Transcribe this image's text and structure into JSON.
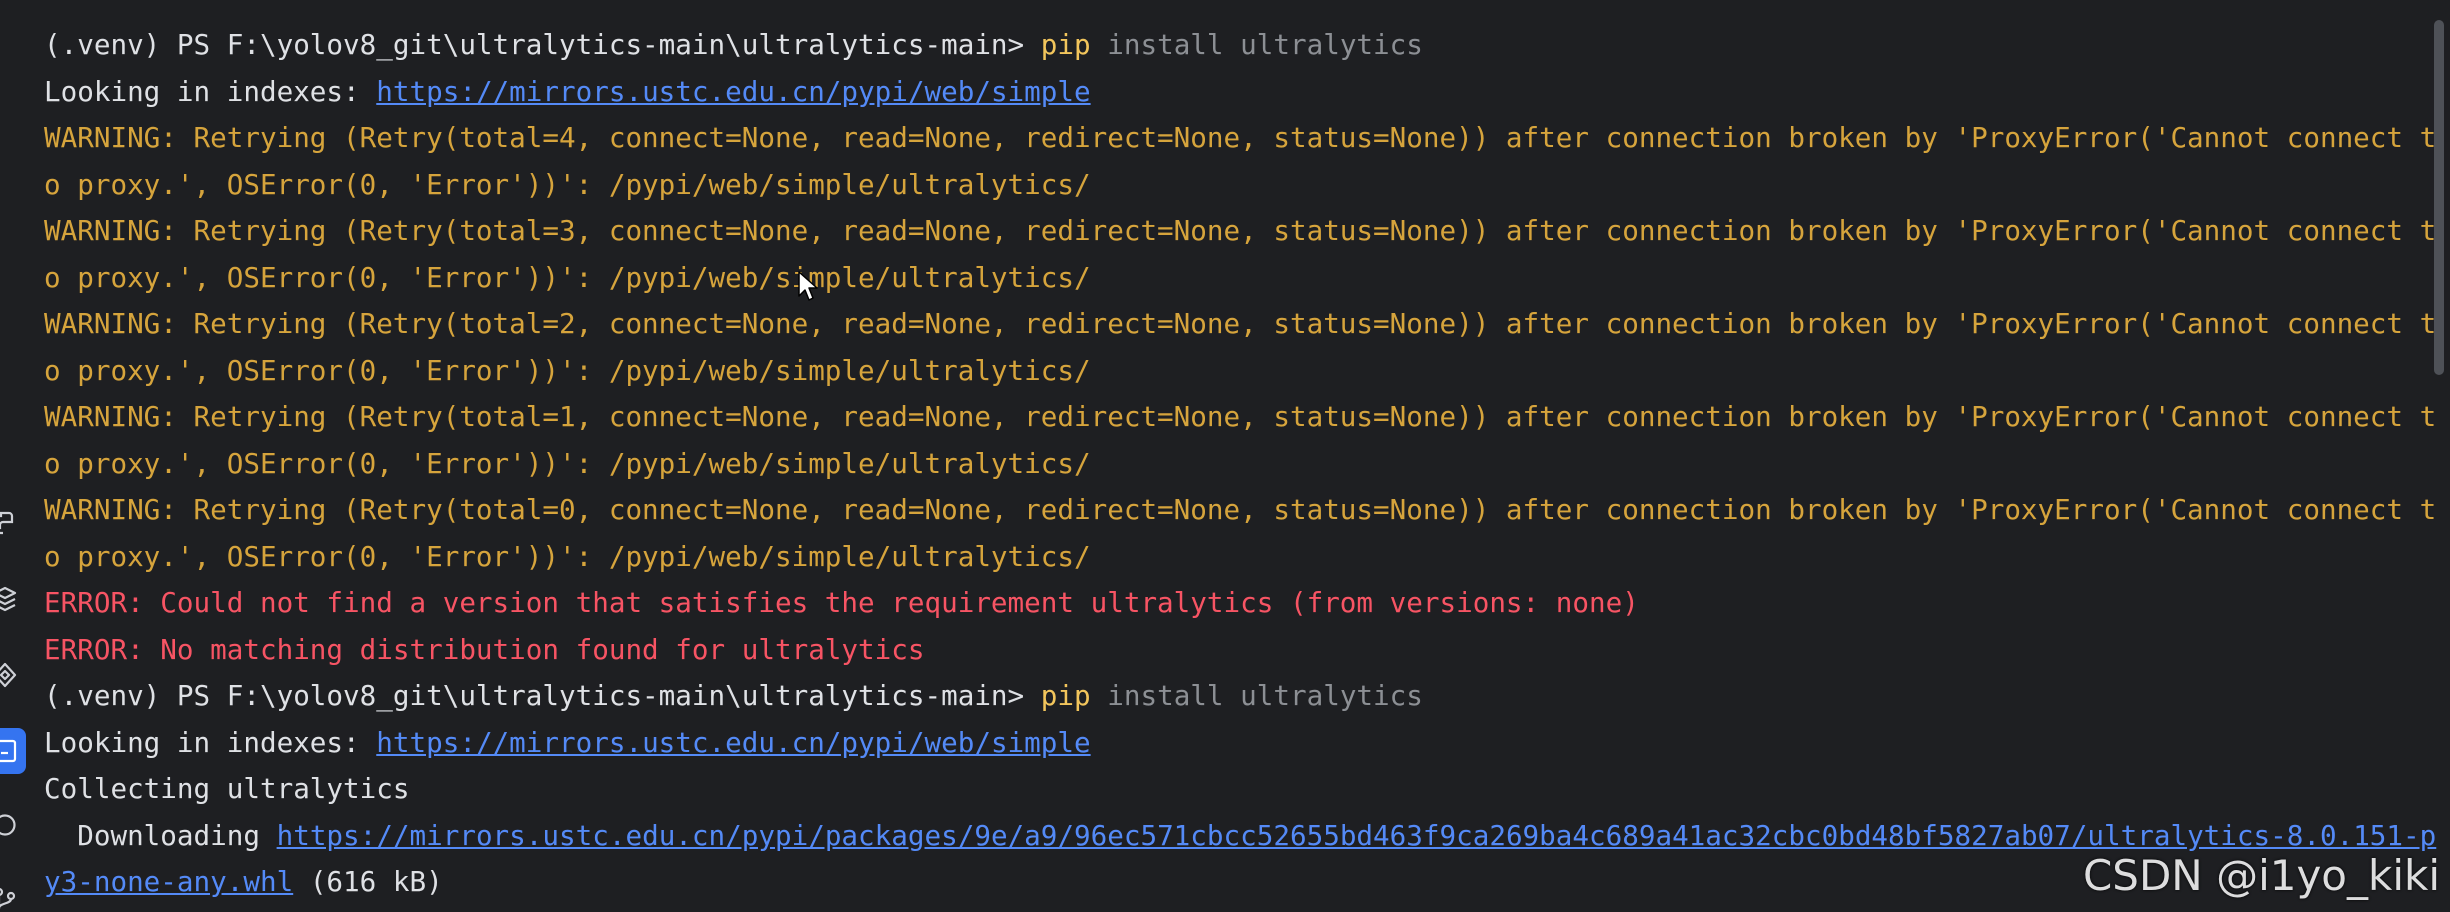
{
  "terminal": {
    "lines": [
      {
        "type": "command",
        "prompt": "(.venv) PS F:\\yolov8_git\\ultralytics-main\\ultralytics-main> ",
        "cmd": "pip",
        "args": " install ultralytics"
      },
      {
        "type": "index",
        "text": "Looking in indexes: ",
        "link": "https://mirrors.ustc.edu.cn/pypi/web/simple"
      },
      {
        "type": "warn",
        "text": "WARNING: Retrying (Retry(total=4, connect=None, read=None, redirect=None, status=None)) after connection broken by 'ProxyError('Cannot connect t"
      },
      {
        "type": "warn",
        "text": "o proxy.', OSError(0, 'Error'))': /pypi/web/simple/ultralytics/"
      },
      {
        "type": "warn",
        "text": "WARNING: Retrying (Retry(total=3, connect=None, read=None, redirect=None, status=None)) after connection broken by 'ProxyError('Cannot connect t"
      },
      {
        "type": "warn",
        "text": "o proxy.', OSError(0, 'Error'))': /pypi/web/simple/ultralytics/"
      },
      {
        "type": "warn",
        "text": "WARNING: Retrying (Retry(total=2, connect=None, read=None, redirect=None, status=None)) after connection broken by 'ProxyError('Cannot connect t"
      },
      {
        "type": "warn",
        "text": "o proxy.', OSError(0, 'Error'))': /pypi/web/simple/ultralytics/"
      },
      {
        "type": "warn",
        "text": "WARNING: Retrying (Retry(total=1, connect=None, read=None, redirect=None, status=None)) after connection broken by 'ProxyError('Cannot connect t"
      },
      {
        "type": "warn",
        "text": "o proxy.', OSError(0, 'Error'))': /pypi/web/simple/ultralytics/"
      },
      {
        "type": "warn",
        "text": "WARNING: Retrying (Retry(total=0, connect=None, read=None, redirect=None, status=None)) after connection broken by 'ProxyError('Cannot connect t"
      },
      {
        "type": "warn",
        "text": "o proxy.', OSError(0, 'Error'))': /pypi/web/simple/ultralytics/"
      },
      {
        "type": "error",
        "text": "ERROR: Could not find a version that satisfies the requirement ultralytics (from versions: none)"
      },
      {
        "type": "error",
        "text": "ERROR: No matching distribution found for ultralytics"
      },
      {
        "type": "command",
        "prompt": "(.venv) PS F:\\yolov8_git\\ultralytics-main\\ultralytics-main> ",
        "cmd": "pip",
        "args": " install ultralytics"
      },
      {
        "type": "index",
        "text": "Looking in indexes: ",
        "link": "https://mirrors.ustc.edu.cn/pypi/web/simple"
      },
      {
        "type": "plain",
        "text": "Collecting ultralytics"
      },
      {
        "type": "download",
        "text": "  Downloading ",
        "link": "https://mirrors.ustc.edu.cn/pypi/packages/9e/a9/96ec571cbcc52655bd463f9ca269ba4c689a41ac32cbc0bd48bf5827ab07/ultralytics-8.0.151-p"
      },
      {
        "type": "download-end",
        "link": "y3-none-any.whl",
        "text": " (616 kB)"
      }
    ]
  },
  "watermark": "CSDN @i1yo_kiki",
  "sidebar": {
    "icons": [
      "python-packages-icon",
      "layers-icon",
      "services-icon",
      "terminal-icon",
      "problems-icon",
      "git-icon"
    ]
  },
  "colors": {
    "background": "#1e1f22",
    "text": "#dfe1e5",
    "command": "#f2c55c",
    "args": "#8c8f94",
    "link": "#548af7",
    "warning": "#d6a43c",
    "error": "#f75464",
    "accent": "#3574f0"
  }
}
